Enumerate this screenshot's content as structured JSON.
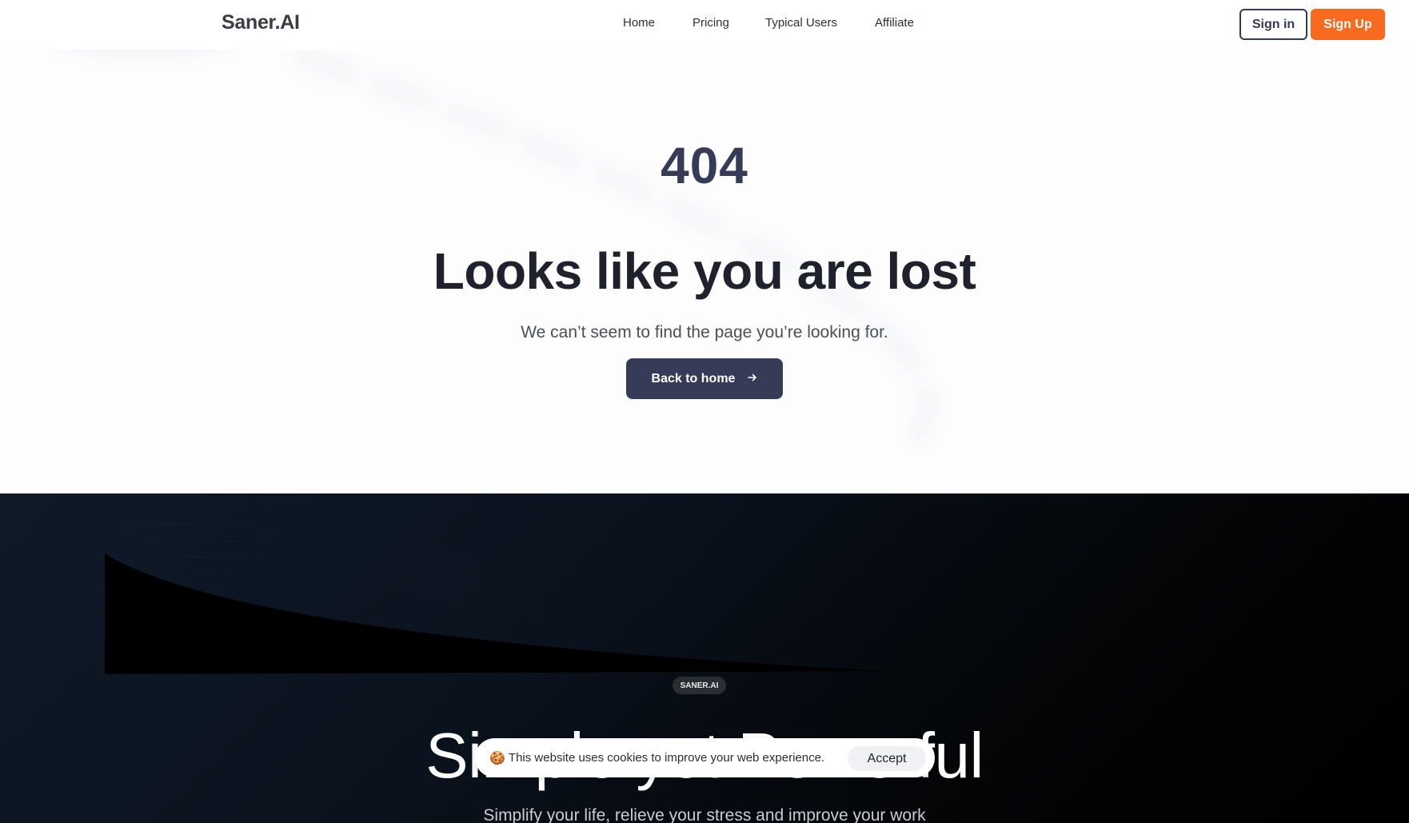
{
  "header": {
    "logo": "Saner.AI",
    "nav": [
      {
        "label": "Home"
      },
      {
        "label": "Pricing"
      },
      {
        "label": "Typical Users"
      },
      {
        "label": "Affiliate"
      }
    ],
    "signin_label": "Sign in",
    "signup_label": "Sign Up"
  },
  "error": {
    "code": "404",
    "title": "Looks like you are lost",
    "subtitle": "We can’t seem to find the page you’re looking for.",
    "back_label": "Back to home",
    "back_icon": "arrow-right-icon"
  },
  "promo": {
    "badge": "SANER.AI",
    "title": "Simple yet Powerful",
    "subtitle": "Simplify your life, relieve your stress and improve your work"
  },
  "cookie": {
    "icon": "cookie-icon",
    "text": "This website uses cookies to improve your web experience.",
    "accept_label": "Accept"
  },
  "colors": {
    "primary": "#363c58",
    "accent": "#f96a21",
    "dark_bg": "#000000"
  }
}
